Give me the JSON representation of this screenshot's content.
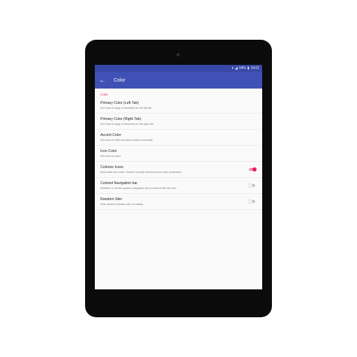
{
  "status_bar": {
    "battery": "54%",
    "time": "19:01",
    "wifi_icon": "wifi-icon",
    "signal_icon": "signal-icon",
    "battery_icon": "battery-icon"
  },
  "app_bar": {
    "title": "Color",
    "back_icon": "arrow-left-icon",
    "color": "#3f51b5"
  },
  "section": {
    "header": "Color",
    "header_color": "#e91e63"
  },
  "preferences": [
    {
      "title": "Primary Color (Left Tab)",
      "summary": "Set color to large ui elements for the left tab"
    },
    {
      "title": "Primary Color (Right Tab)",
      "summary": "Set color to large ui elements for the right tab."
    },
    {
      "title": "Accent Color",
      "summary": "Set color to FAB and other small ui elements"
    },
    {
      "title": "Icon Color",
      "summary": "Set color to icons"
    },
    {
      "title": "Colorize Icons",
      "summary": "Sets static icon color. Doesn't override directory icon color preference",
      "switch": true
    },
    {
      "title": "Colored Navigation bar",
      "summary": "Whether or not the system navigation bar is colored with the skin",
      "switch": false
    },
    {
      "title": "Random Skin",
      "summary": "Sets random primary color at startup",
      "switch": false
    }
  ]
}
